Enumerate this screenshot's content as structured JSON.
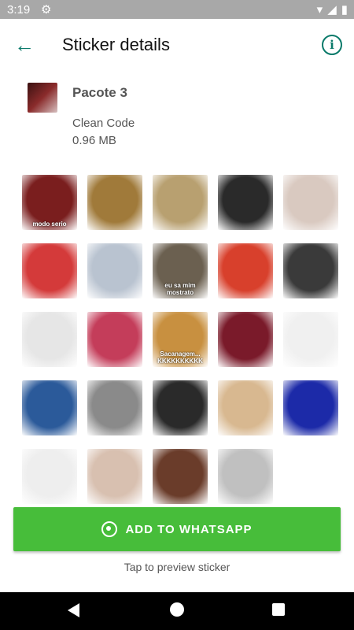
{
  "status_bar": {
    "time": "3:19"
  },
  "toolbar": {
    "title": "Sticker details",
    "back_icon": "arrow-left-icon",
    "info_icon": "info-icon"
  },
  "pack": {
    "name": "Pacote 3",
    "author": "Clean Code",
    "size": "0.96 MB"
  },
  "stickers": [
    {
      "id": 1,
      "caption": "modo serio",
      "color": "#7a1e1e"
    },
    {
      "id": 2,
      "caption": "",
      "color": "#a07a3a"
    },
    {
      "id": 3,
      "caption": "",
      "color": "#b8a070"
    },
    {
      "id": 4,
      "caption": "",
      "color": "#2a2a2a"
    },
    {
      "id": 5,
      "caption": "",
      "color": "#d9c9c0"
    },
    {
      "id": 6,
      "caption": "",
      "color": "#d43a3a"
    },
    {
      "id": 7,
      "caption": "",
      "color": "#b9c3d0"
    },
    {
      "id": 8,
      "caption": "eu sa mim mostrato",
      "color": "#6b6050"
    },
    {
      "id": 9,
      "caption": "",
      "color": "#d8402c"
    },
    {
      "id": 10,
      "caption": "",
      "color": "#3a3a3a"
    },
    {
      "id": 11,
      "caption": "",
      "color": "#e6e6e6"
    },
    {
      "id": 12,
      "caption": "",
      "color": "#c43d5a"
    },
    {
      "id": 13,
      "caption": "Sacanagem... KKKKKKKKKK",
      "color": "#c89040"
    },
    {
      "id": 14,
      "caption": "",
      "color": "#7a1a2a"
    },
    {
      "id": 15,
      "caption": "",
      "color": "#f0f0f0"
    },
    {
      "id": 16,
      "caption": "",
      "color": "#2b5a9a"
    },
    {
      "id": 17,
      "caption": "",
      "color": "#8a8a8a"
    },
    {
      "id": 18,
      "caption": "",
      "color": "#2a2a2a"
    },
    {
      "id": 19,
      "caption": "",
      "color": "#d8b890"
    },
    {
      "id": 20,
      "caption": "",
      "color": "#1c2aa8"
    },
    {
      "id": 21,
      "caption": "",
      "color": "#eeeeee"
    },
    {
      "id": 22,
      "caption": "",
      "color": "#d8c0b0"
    },
    {
      "id": 23,
      "caption": "",
      "color": "#6a3c2a"
    },
    {
      "id": 24,
      "caption": "",
      "color": "#c0c0c0"
    }
  ],
  "actions": {
    "add_label": "ADD TO WHATSAPP",
    "hint": "Tap to preview sticker"
  }
}
